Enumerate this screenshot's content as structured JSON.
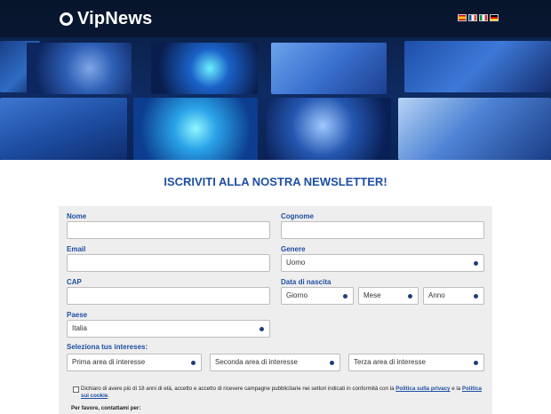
{
  "header": {
    "logo_text": "VipNews",
    "language_flags": [
      "flag-es-icon",
      "flag-fr-icon",
      "flag-it-icon",
      "flag-de-icon"
    ]
  },
  "main": {
    "title": "ISCRIVITI ALLA NOSTRA NEWSLETTER!"
  },
  "form": {
    "nome_label": "Nome",
    "nome_value": "",
    "cognome_label": "Cognome",
    "cognome_value": "",
    "email_label": "Email",
    "email_value": "",
    "genere_label": "Genere",
    "genere_value": "Uomo",
    "cap_label": "CAP",
    "cap_value": "",
    "nascita_label": "Data di nascita",
    "giorno_value": "Giorno",
    "mese_value": "Mese",
    "anno_value": "Anno",
    "paese_label": "Paese",
    "paese_value": "Italia",
    "interessi_label": "Seleziona tus intereses:",
    "interesse1_value": "Prima area di interesse",
    "interesse2_value": "Seconda area di interesse",
    "interesse3_value": "Terza area di interesse",
    "consent_text": "Dichiaro di avere più di 18 anni di età, accetto e accetto di ricevere campagne pubblicitarie nei settori indicati in conformità con la",
    "privacy_link": "Politica sulla privacy",
    "consent_and": "e la",
    "cookie_link": "Politica sui cookie",
    "consent_end": ".",
    "contact_text": "Per favore, contattami per:"
  },
  "colors": {
    "accent": "#1f4ea3",
    "form_bg": "#eeeeee"
  }
}
